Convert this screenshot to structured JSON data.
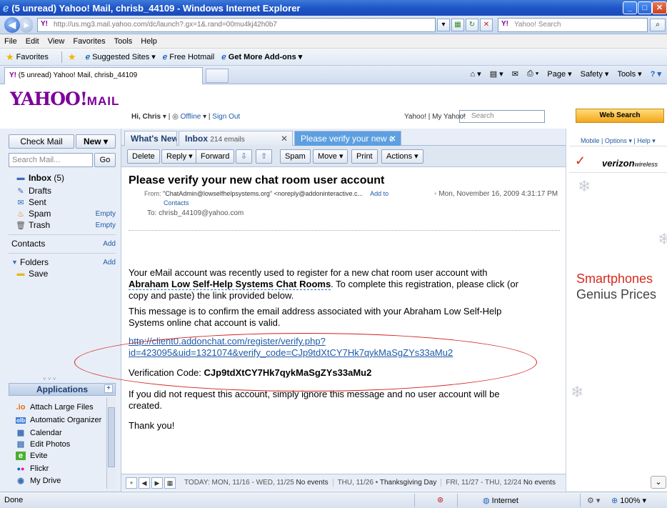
{
  "window": {
    "title": "(5 unread) Yahoo! Mail, chrisb_44109 - Windows Internet Explorer",
    "address_url": "http://us.mg3.mail.yahoo.com/dc/launch?.gx=1&.rand=00mu4kj42h0b7",
    "address_domain_bold": "yahoo.com",
    "search_placeholder": "Yahoo! Search"
  },
  "menu": [
    "File",
    "Edit",
    "View",
    "Favorites",
    "Tools",
    "Help"
  ],
  "favorites_bar": {
    "favorites_label": "Favorites",
    "items": [
      "Suggested Sites ▾",
      "Free Hotmail",
      "Get More Add-ons ▾"
    ]
  },
  "ie_tab": {
    "label": "(5 unread) Yahoo! Mail, chrisb_44109"
  },
  "command_bar": [
    "Page ▾",
    "Safety ▾",
    "Tools ▾"
  ],
  "yahoo_header": {
    "logo": "YAHOO!",
    "logo_suffix": "MAIL",
    "greeting": "Hi, Chris",
    "status": "Offline",
    "sign_out": "Sign Out",
    "links": "Yahoo! | My Yahoo!",
    "search_placeholder": "Search",
    "web_search": "Web Search"
  },
  "sidebar": {
    "check_mail": "Check Mail",
    "new_button": "New",
    "search_placeholder": "Search Mail...",
    "go": "Go",
    "folders": [
      {
        "label": "Inbox",
        "count": "(5)",
        "action": ""
      },
      {
        "label": "Drafts",
        "count": "",
        "action": ""
      },
      {
        "label": "Sent",
        "count": "",
        "action": ""
      },
      {
        "label": "Spam",
        "count": "",
        "action": "Empty"
      },
      {
        "label": "Trash",
        "count": "",
        "action": "Empty"
      }
    ],
    "contacts": "Contacts",
    "contacts_add": "Add",
    "folders_header": "Folders",
    "folders_add": "Add",
    "custom_folders": [
      "Save"
    ],
    "applications_header": "Applications",
    "applications": [
      "Attach Large Files",
      "Automatic Organizer",
      "Calendar",
      "Edit Photos",
      "Evite",
      "Flickr",
      "My Drive"
    ]
  },
  "mail_tabs": [
    {
      "label": "What's New",
      "count": ""
    },
    {
      "label": "Inbox",
      "count": "214 emails"
    },
    {
      "label": "Please verify your new c",
      "count": ""
    }
  ],
  "toolbar": {
    "delete": "Delete",
    "reply": "Reply",
    "forward": "Forward",
    "spam": "Spam",
    "move": "Move",
    "print": "Print",
    "actions": "Actions"
  },
  "message": {
    "subject": "Please verify your new chat room user account",
    "from_label": "From:",
    "from": "\"ChatAdmin@lowselfhelpsystems.org\" <noreply@addoninteractive.c...",
    "add_to": "Add to",
    "contacts": "Contacts",
    "date": "Mon, November 16, 2009 4:31:17 PM",
    "to_label": "To:",
    "to": "chrisb_44109@yahoo.com",
    "p1_a": "Your eMail account was recently used to register for a new chat room user account with",
    "p1_bold": "Abraham Low Self-Help Systems Chat Rooms",
    "p1_b": ". To complete this registration, please click (or",
    "p1_c": "copy and paste) the link provided below.",
    "p2_a": "This message is to confirm the email address associated with your Abraham Low Self-Help",
    "p2_b": "Systems online chat account is valid.",
    "link_1": "http://client0.addonchat.com/register/verify.php?",
    "link_2": "id=423095&uid=1321074&verify_code=CJp9tdXtCY7Hk7qykMaSgZYs33aMu2",
    "code_label": "Verification Code:",
    "code": "CJp9tdXtCY7Hk7qykMaSgZYs33aMu2",
    "p3_a": "If you did not request this account, simply ignore this message and no user account will be",
    "p3_b": "created.",
    "thanks": "Thank you!"
  },
  "calendar_bar": {
    "today": "TODAY: MON, 11/16 - WED, 11/25",
    "today_events": "No events",
    "thu": "THU, 11/26",
    "thu_event": "Thanksgiving Day",
    "fri": "FRI, 11/27 - THU, 12/24",
    "fri_events": "No events"
  },
  "ad_column": {
    "links": "Mobile | Options ▾ | Help ▾",
    "brand": "verizon",
    "brand_suffix": "wireless",
    "line1": "Smartphones",
    "line2": "Genius Prices"
  },
  "statusbar": {
    "status": "Done",
    "zone": "Internet",
    "zoom": "100%"
  }
}
